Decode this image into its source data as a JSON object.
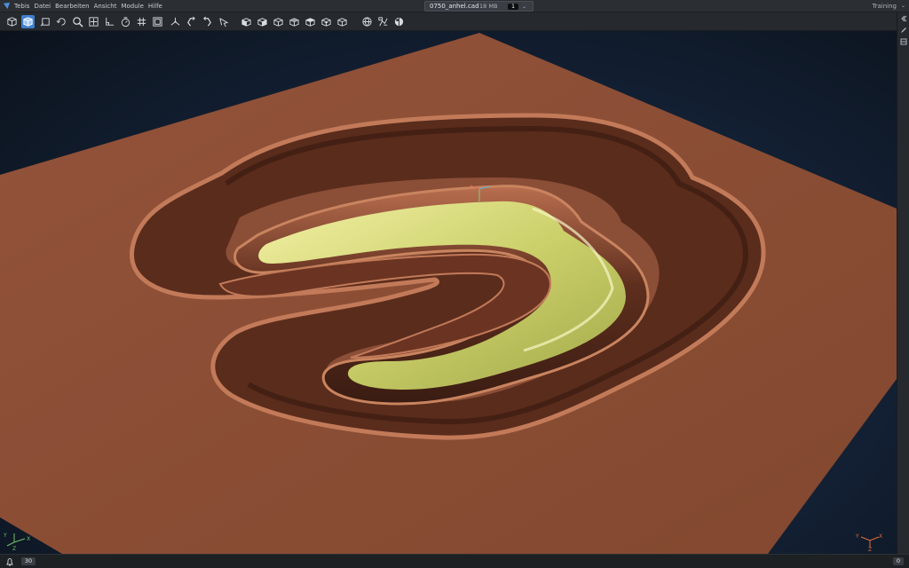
{
  "menu": [
    "Tebis",
    "Datei",
    "Bearbeiten",
    "Ansicht",
    "Module",
    "Hilfe"
  ],
  "file_tab": {
    "name": "0750_anhel.cad",
    "size": "18 MB",
    "window_count": "1"
  },
  "profile": "Training",
  "toolbar": {
    "group1": [
      "view-cube-icon",
      "shaded-view-icon",
      "rotate-view-icon",
      "refresh-view-icon",
      "zoom-icon",
      "zoom-fit-icon",
      "angle-icon",
      "timer-icon",
      "grid-icon",
      "frame-icon",
      "axis-icon",
      "rotate-left-icon",
      "rotate-right-icon",
      "pointer-icon"
    ],
    "group2": [
      "view-front-icon",
      "view-back-icon",
      "view-left-icon",
      "view-right-icon",
      "view-top-icon",
      "view-bottom-icon",
      "view-iso-icon"
    ],
    "group3": [
      "globe-icon",
      "tools-icon",
      "material-icon"
    ],
    "active": "shaded-view-icon"
  },
  "statusbar": {
    "notification_count": "30",
    "right_count": "0"
  },
  "colors": {
    "part_surface": "#8b4e37",
    "selected_faces": "#d9dc7a",
    "accent": "#3f7fd0"
  }
}
